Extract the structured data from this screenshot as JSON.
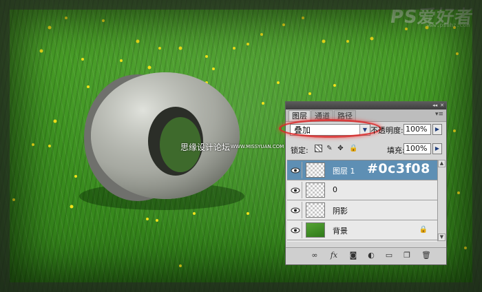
{
  "watermark": {
    "site_cn": "思缘设计论坛",
    "site_url": "WWW.MISSYUAN.COM",
    "logo_text": "PS爱好者",
    "logo_url": "www.psahz.com"
  },
  "panel": {
    "tabs": [
      {
        "label": "图层",
        "active": true
      },
      {
        "label": "通道",
        "active": false
      },
      {
        "label": "路径",
        "active": false
      }
    ],
    "title_icons": [
      "collapse-icon",
      "close-icon"
    ],
    "blend_mode": "叠加",
    "opacity_label": "不透明度:",
    "opacity_value": "100%",
    "lock_label": "锁定:",
    "fill_label": "填充:",
    "fill_value": "100%",
    "layers": [
      {
        "name": "图层 1",
        "selected": true,
        "thumb": "transparent"
      },
      {
        "name": "0",
        "selected": false,
        "thumb": "transparent"
      },
      {
        "name": "阴影",
        "selected": false,
        "thumb": "transparent"
      },
      {
        "name": "背景",
        "selected": false,
        "thumb": "grass",
        "locked": true
      }
    ],
    "annotation": "#0c3f08",
    "bottom_icons": [
      "link-icon",
      "fx-icon",
      "mask-icon",
      "adjustment-icon",
      "folder-icon",
      "new-layer-icon",
      "trash-icon"
    ],
    "fx_label": "fx",
    "colors": {
      "selected_row": "#5e8fb4",
      "highlight_oval": "#dc2828"
    }
  }
}
